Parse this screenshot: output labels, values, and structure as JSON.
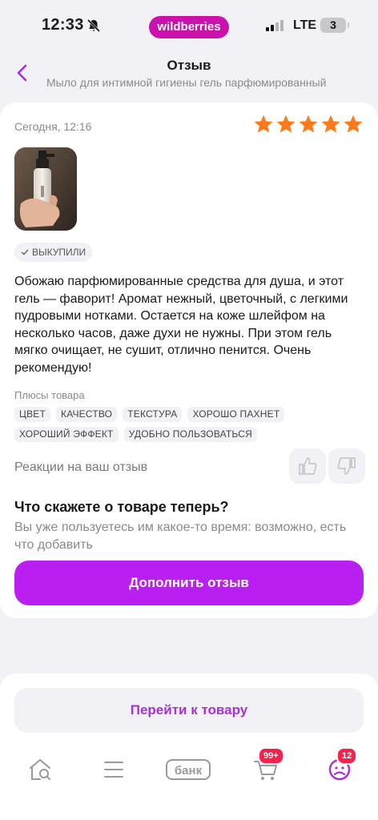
{
  "status_bar": {
    "time": "12:33",
    "brand": "wildberries",
    "network": "LTE",
    "battery": "3"
  },
  "header": {
    "title": "Отзыв",
    "subtitle": "Мыло для интимной гигиены гель парфюмированный"
  },
  "review": {
    "date": "Сегодня, 12:16",
    "rating": 5,
    "rating_max": 5,
    "bought_badge": "ВЫКУПИЛИ",
    "text": "Обожаю парфюмированные средства для душа, и этот гель — фаворит! Аромат нежный, цветочный, с легкими пудровыми нотками. Остается на коже шлейфом на несколько часов, даже духи не нужны. При этом гель мягко очищает, не сушит, отлично пенится. Очень рекомендую!",
    "pros_label": "Плюсы товара",
    "tags": [
      "ЦВЕТ",
      "КАЧЕСТВО",
      "ТЕКСТУРА",
      "ХОРОШО ПАХНЕТ",
      "ХОРОШИЙ ЭФФЕКТ",
      "УДОБНО ПОЛЬЗОВАТЬСЯ"
    ],
    "reactions_label": "Реакции на ваш отзыв"
  },
  "prompt": {
    "title": "Что скажете о товаре теперь?",
    "text": "Вы уже пользуетесь им какое-то время: возможно, есть что добавить",
    "button": "Дополнить отзыв"
  },
  "goto_product": "Перейти к товару",
  "tabbar": {
    "bank_label": "банк",
    "cart_badge": "99+",
    "profile_badge": "12"
  },
  "colors": {
    "brand": "#cb11ab",
    "accent_button": "#b920f0",
    "star": "#ff7a1a",
    "badge": "#f5224c"
  }
}
